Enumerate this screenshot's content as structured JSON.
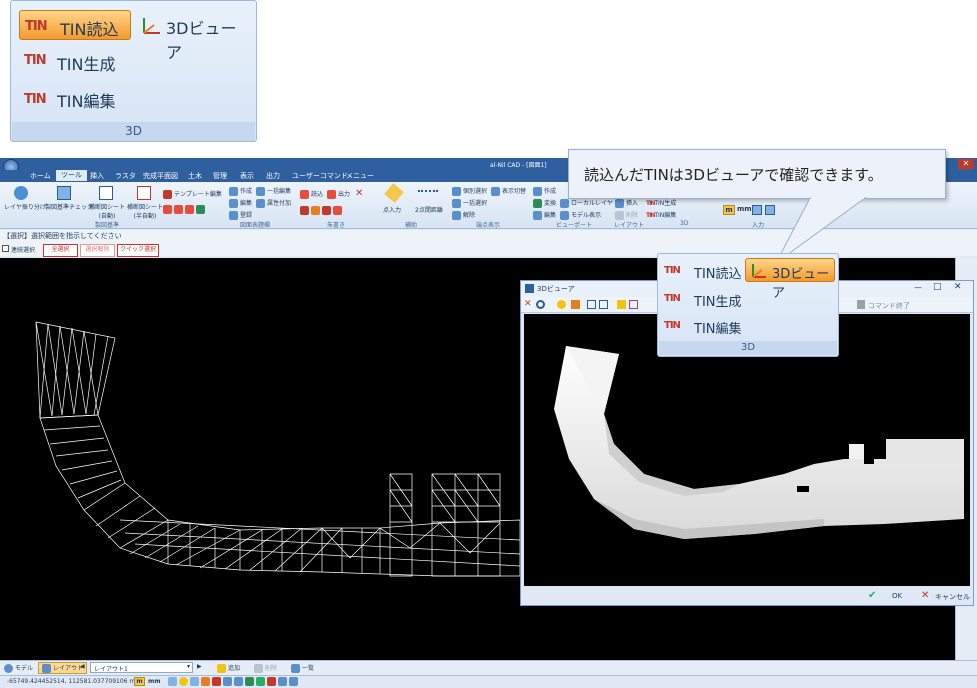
{
  "top_panel": {
    "tin_read": "TIN読込",
    "viewer_3d": "3Dビューア",
    "tin_generate": "TIN生成",
    "tin_edit": "TIN編集",
    "group": "3D"
  },
  "app": {
    "title": "al-Nil CAD - [図面1]",
    "tabs": [
      "ホーム",
      "ツール",
      "挿入",
      "ラスタ",
      "完成平面図",
      "土木",
      "管理",
      "表示",
      "出力",
      "ユーザーコマンド",
      "メニュー"
    ],
    "active_tab": "ツール"
  },
  "ribbon": {
    "layer_split": "レイヤ振り分け",
    "drawing_check": "製図基準チェック",
    "cross_sheet": "横断図シート\n(自動)",
    "cross_sheet_half": "横断図シート\n(半自動)",
    "template_edit": "テンプレート編集",
    "create": "作成",
    "bulk_edit": "一括編集",
    "edit": "編集",
    "attr_add": "属性付加",
    "register": "登録",
    "read": "読込",
    "output": "出力",
    "point_input": "点入力",
    "two_point_dist": "2点間距離",
    "indiv_select": "個別選択",
    "display_switch": "表示切替",
    "bulk_select": "一括選択",
    "release": "解除",
    "vp_create": "作成",
    "vp_convert": "変換",
    "vp_local_layer": "ローカルレイヤ",
    "vp_edit": "編集",
    "vp_model_display": "モデル表示",
    "layout_insert": "挿入",
    "layout_delete": "削除",
    "tin_generate": "TIN生成",
    "tin_edit": "TIN編集",
    "input_m": "m",
    "input_mm": "mm",
    "groups": [
      "製図基準",
      "図面表題欄",
      "朱書き",
      "補助",
      "端点表示",
      "ビューポート",
      "レイアウト",
      "3D",
      "入力"
    ]
  },
  "command_bar": {
    "prompt": "【選択】選択範囲を指示してください",
    "continuous": "連続選択",
    "select_all": "全選択",
    "release_select": "選択解除",
    "quick_select": "クイック選択"
  },
  "callout": {
    "text": "読込んだTINは3Dビューアで確認できます。"
  },
  "popup": {
    "tin_read": "TIN読込",
    "viewer_3d": "3Dビューア",
    "tin_generate": "TIN生成",
    "tin_edit": "TIN編集",
    "group": "3D"
  },
  "viewer_window": {
    "title": "3Dビューア",
    "end_command": "コマンド終了",
    "ok": "OK",
    "cancel": "キャンセル"
  },
  "bottom": {
    "model_tab": "モデル",
    "layout_tab": "レイアウト",
    "layout_select": "レイアウト1",
    "add": "追加",
    "delete": "削除",
    "list": "一覧",
    "coords": "-65749.424452514, 112581.037709106 m",
    "unit_m": "m",
    "unit_mm": "mm"
  },
  "colors": {
    "accent": "#f39a2d",
    "title_bar": "#2e5f9e",
    "ribbon": "#dfeaf7",
    "canvas": "#000000"
  }
}
